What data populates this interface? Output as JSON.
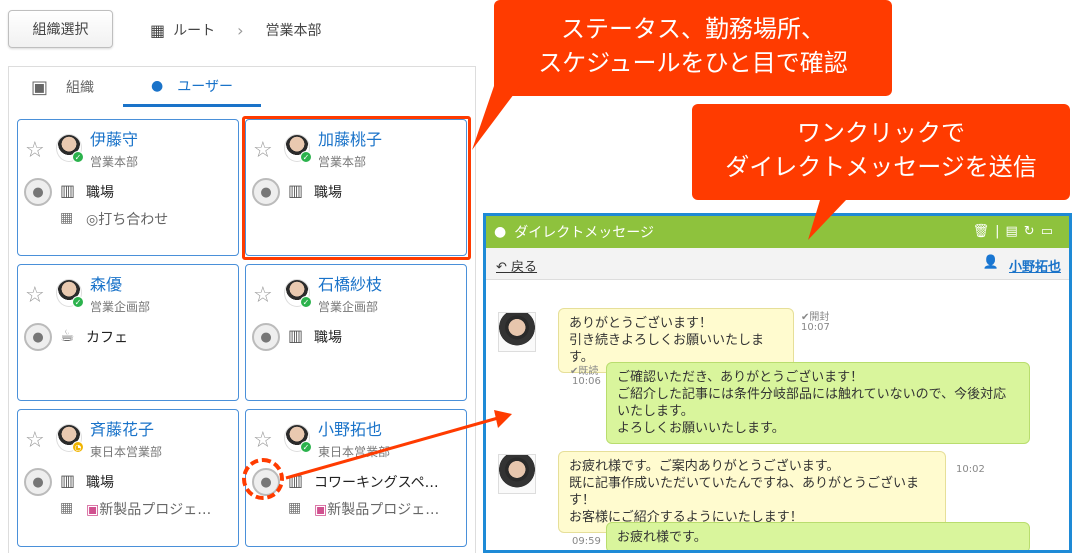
{
  "header": {
    "org_select_button": "組織選択",
    "breadcrumb": [
      "ルート",
      "営業本部"
    ]
  },
  "tabs": [
    {
      "label": "組織",
      "active": false
    },
    {
      "label": "ユーザー",
      "active": true
    }
  ],
  "users": [
    {
      "name": "伊藤守",
      "dept": "営業本部",
      "location": "職場",
      "schedule": "打ち合わせ",
      "status": "online"
    },
    {
      "name": "加藤桃子",
      "dept": "営業本部",
      "location": "職場",
      "schedule": "",
      "status": "online"
    },
    {
      "name": "森優",
      "dept": "営業企画部",
      "location": "カフェ",
      "schedule": "",
      "status": "online"
    },
    {
      "name": "石橋紗枝",
      "dept": "営業企画部",
      "location": "職場",
      "schedule": "",
      "status": "online"
    },
    {
      "name": "斉藤花子",
      "dept": "東日本営業部",
      "location": "職場",
      "schedule": "新製品プロジェ…",
      "status": "away"
    },
    {
      "name": "小野拓也",
      "dept": "東日本営業部",
      "location": "コワーキングスペ…",
      "schedule": "新製品プロジェ…",
      "status": "online"
    }
  ],
  "callouts": {
    "top": [
      "ステータス、勤務場所、",
      "スケジュールをひと目で確認"
    ],
    "dm": [
      "ワンクリックで",
      "ダイレクトメッセージを送信"
    ]
  },
  "dm": {
    "title": "ダイレクトメッセージ",
    "back": "戻る",
    "partner": "小野拓也",
    "messages": [
      {
        "dir": "in",
        "text": "ありがとうございます！\n引き続きよろしくお願いいたします。",
        "time": "10:07",
        "read": "開封"
      },
      {
        "dir": "out",
        "text": "ご確認いただき、ありがとうございます！\nご紹介した記事には条件分岐部品には触れていないので、今後対応いたします。\nよろしくお願いいたします。",
        "time": "10:06",
        "read": "既読"
      },
      {
        "dir": "in",
        "text": "お疲れ様です。ご案内ありがとうございます。\n既に記事作成いただいていたんですね、ありがとうございます！\nお客様にご紹介するようにいたします！",
        "time": "10:02",
        "read": ""
      },
      {
        "dir": "out",
        "text": "お疲れ様です。",
        "time": "09:59",
        "read": ""
      }
    ]
  },
  "colors": {
    "accent": "#1a73c9",
    "callout": "#ff3b00",
    "dm_title": "#8ec23d",
    "online": "#2bb24c",
    "away": "#f0b400"
  }
}
